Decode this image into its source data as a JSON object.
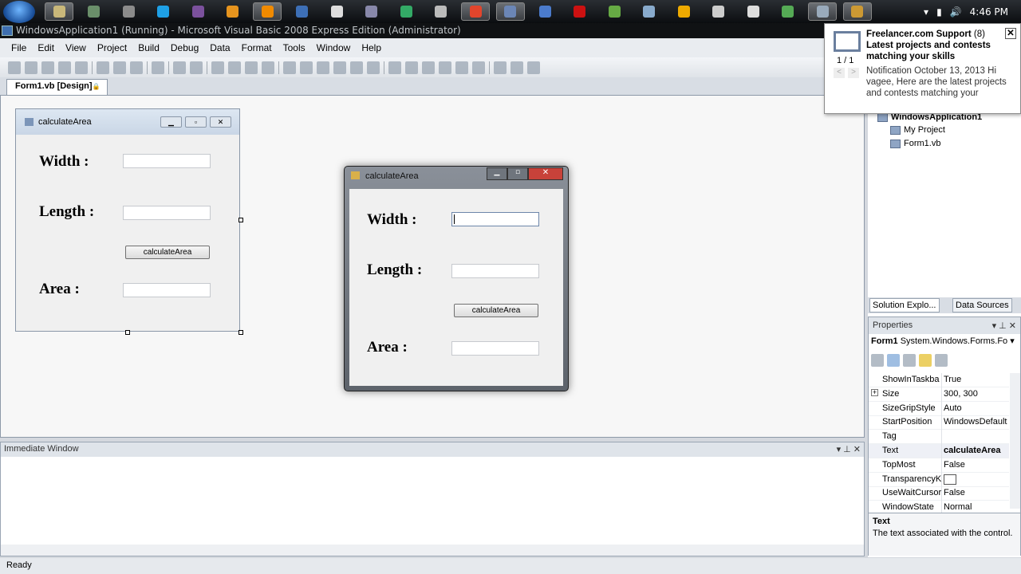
{
  "taskbar": {
    "icons": [
      "explorer",
      "remote-desktop",
      "network",
      "skype",
      "viber",
      "media",
      "vlc",
      "monitor",
      "chat",
      "tool",
      "color-app",
      "app",
      "chrome",
      "visual-basic",
      "ie",
      "acrobat",
      "game",
      "cube",
      "infinity",
      "notes",
      "paint",
      "android",
      "document",
      "vb-running"
    ],
    "tray": {
      "time": "4:46 PM"
    }
  },
  "window": {
    "title": "WindowsApplication1 (Running) - Microsoft Visual Basic 2008 Express Edition (Administrator)"
  },
  "menu": [
    "File",
    "Edit",
    "View",
    "Project",
    "Build",
    "Debug",
    "Data",
    "Format",
    "Tools",
    "Window",
    "Help"
  ],
  "doc_tab": "Form1.vb [Design]",
  "design_form": {
    "title": "calculateArea",
    "width_label": "Width :",
    "length_label": "Length :",
    "button": "calculateArea",
    "area_label": "Area :"
  },
  "running_form": {
    "title": "calculateArea",
    "width_label": "Width :",
    "length_label": "Length :",
    "button": "calculateArea",
    "area_label": "Area :",
    "width_value": "",
    "length_value": "",
    "area_value": ""
  },
  "notification": {
    "sender": "Freelancer.com Support",
    "count": "(8)",
    "subject": "Latest projects and contests matching your skills",
    "body": "Notification October 13, 2013 Hi vagee, Here are the latest projects and contests matching your",
    "pager": "1 / 1",
    "prev": "<",
    "next": ">"
  },
  "solution_explorer": {
    "project": "WindowsApplication1",
    "items": [
      "My Project",
      "Form1.vb"
    ],
    "tabs": [
      "Solution Explo...",
      "Data Sources"
    ]
  },
  "properties": {
    "title": "Properties",
    "object": "Form1",
    "type": "System.Windows.Forms.Fo",
    "rows": [
      {
        "name": "ShowInTaskba",
        "value": "True"
      },
      {
        "name": "Size",
        "value": "300, 300",
        "expand": "+"
      },
      {
        "name": "SizeGripStyle",
        "value": "Auto"
      },
      {
        "name": "StartPosition",
        "value": "WindowsDefault"
      },
      {
        "name": "Tag",
        "value": ""
      },
      {
        "name": "Text",
        "value": "calculateArea",
        "bold": true
      },
      {
        "name": "TopMost",
        "value": "False"
      },
      {
        "name": "TransparencyK",
        "value": ""
      },
      {
        "name": "UseWaitCursor",
        "value": "False"
      },
      {
        "name": "WindowState",
        "value": "Normal"
      }
    ],
    "desc_title": "Text",
    "desc": "The text associated with the control."
  },
  "immediate": {
    "title": "Immediate Window"
  },
  "status": "Ready"
}
